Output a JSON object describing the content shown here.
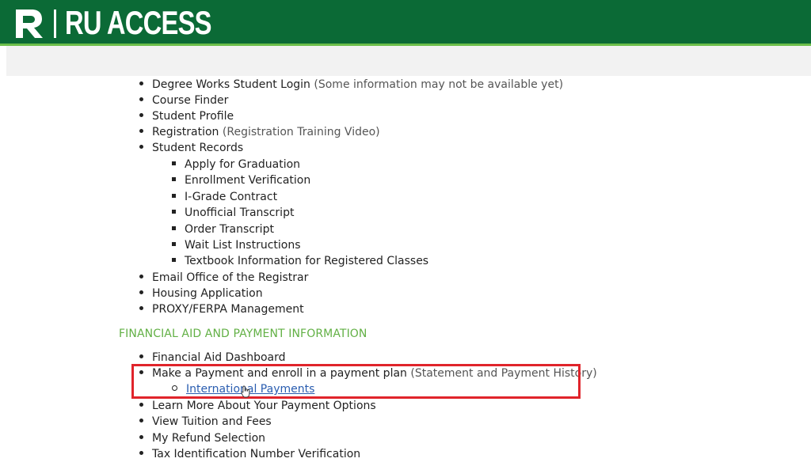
{
  "header": {
    "logo_text": "RU ACCESS",
    "brand_color": "#0b6a36",
    "accent_color": "#6cbf4a"
  },
  "student_links": [
    {
      "label": "Degree Works Student Login",
      "note": "(Some information may not be available yet)"
    },
    {
      "label": "Course Finder"
    },
    {
      "label": "Student Profile"
    },
    {
      "label": "Registration",
      "note": "(Registration Training Video)"
    },
    {
      "label": "Student Records"
    }
  ],
  "student_records_links": [
    "Apply for Graduation",
    "Enrollment Verification",
    "I-Grade Contract",
    "Unofficial Transcript",
    "Order Transcript",
    "Wait List Instructions",
    "Textbook Information for Registered Classes"
  ],
  "more_links": [
    "Email Office of the Registrar",
    "Housing Application",
    "PROXY/FERPA Management"
  ],
  "financial_section": {
    "heading": "FINANCIAL AID AND PAYMENT INFORMATION",
    "heading_color": "#62b045",
    "items": [
      {
        "label": "Financial Aid Dashboard"
      },
      {
        "label": "Make a Payment and enroll in a payment plan",
        "note": "(Statement and Payment History)"
      }
    ],
    "sub_link": "International Payments",
    "after_items": [
      "Learn More About Your Payment Options",
      "View Tuition and Fees",
      "My Refund Selection",
      "Tax  Identification Number Verification"
    ]
  },
  "highlight_color": "#e0242b"
}
